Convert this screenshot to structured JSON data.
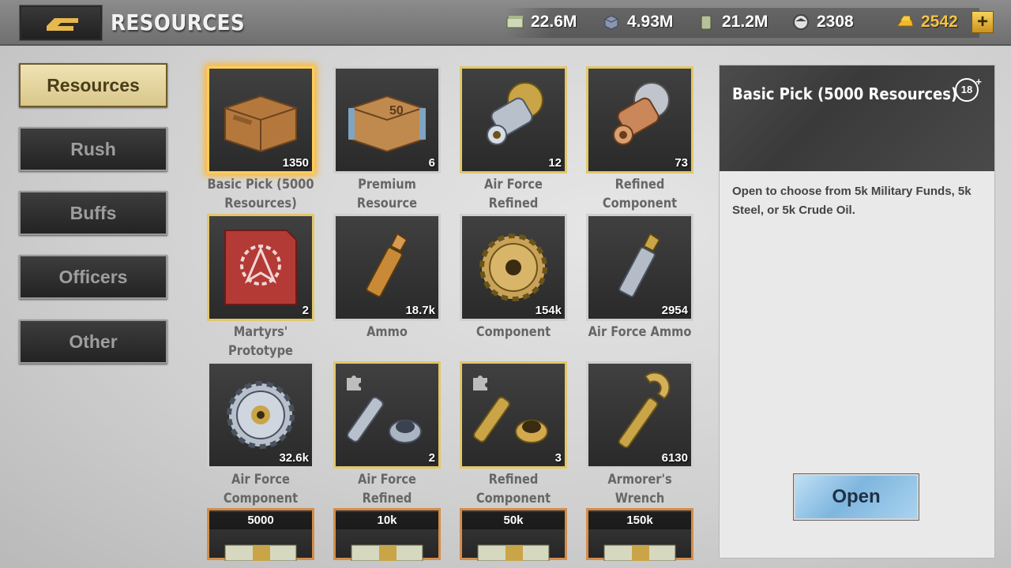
{
  "header": {
    "title": "RESOURCES"
  },
  "currencies": [
    {
      "icon": "cash-icon",
      "value": "22.6M"
    },
    {
      "icon": "steel-icon",
      "value": "4.93M"
    },
    {
      "icon": "oil-icon",
      "value": "21.2M"
    },
    {
      "icon": "soldier-icon",
      "value": "2308"
    },
    {
      "icon": "gold-icon",
      "value": "2542"
    }
  ],
  "sidebar": {
    "items": [
      {
        "label": "Resources",
        "active": true
      },
      {
        "label": "Rush"
      },
      {
        "label": "Buffs"
      },
      {
        "label": "Officers"
      },
      {
        "label": "Other"
      }
    ]
  },
  "items": [
    {
      "name": "Basic Pick (5000\nResources)",
      "qty": "1350",
      "icon": "crate-icon",
      "selected": true
    },
    {
      "name": "Premium Resource\nPick",
      "qty": "6",
      "icon": "premium-crate-icon"
    },
    {
      "name": "Air Force Refined\nComponent",
      "qty": "12",
      "icon": "silver-fitting-icon"
    },
    {
      "name": "Refined\nComponent",
      "qty": "73",
      "icon": "copper-fitting-icon"
    },
    {
      "name": "Martyrs' Prototype\nPiece",
      "qty": "2",
      "icon": "emblem-card-icon"
    },
    {
      "name": "Ammo",
      "qty": "18.7k",
      "icon": "bullet-icon"
    },
    {
      "name": "Component",
      "qty": "154k",
      "icon": "brass-gear-icon"
    },
    {
      "name": "Air Force Ammo",
      "qty": "2954",
      "icon": "silver-bullet-icon"
    },
    {
      "name": "Air Force\nComponent",
      "qty": "32.6k",
      "icon": "silver-gear-icon"
    },
    {
      "name": "Air Force Refined\nComponent Material",
      "qty": "2",
      "icon": "silver-parts-icon"
    },
    {
      "name": "Refined Component\nMaterial",
      "qty": "3",
      "icon": "brass-parts-icon"
    },
    {
      "name": "Armorer's Wrench",
      "qty": "6130",
      "icon": "wrench-icon"
    }
  ],
  "cash_packs": [
    "5000",
    "10k",
    "50k",
    "150k"
  ],
  "detail": {
    "title": "Basic Pick (5000 Resources)",
    "age_badge": "18",
    "description": "Open to choose from 5k Military Funds, 5k Steel, or 5k Crude Oil.",
    "action_label": "Open"
  }
}
